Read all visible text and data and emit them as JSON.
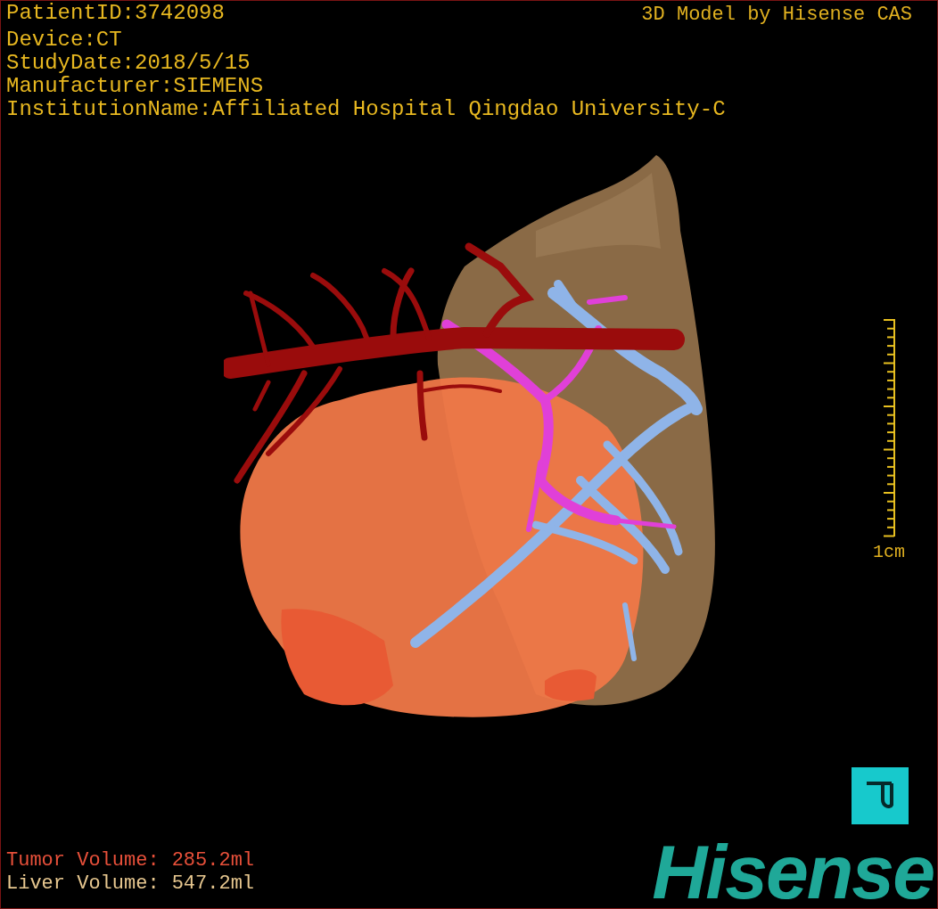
{
  "info_lines": [
    "PatientID:3742098",
    "Device:CT",
    "StudyDate:2018/5/15",
    "Manufacturer:SIEMENS",
    "InstitutionName:Affiliated Hospital Qingdao University-C"
  ],
  "title": "3D Model by Hisense CAS",
  "scale": {
    "label": "1cm"
  },
  "volumes": [
    {
      "label": "Tumor Volume:",
      "value": "285.2ml",
      "color": "#e8503a"
    },
    {
      "label": "Liver Volume:",
      "value": "547.2ml",
      "color": "#e8c890"
    }
  ],
  "logo": "Hisense"
}
